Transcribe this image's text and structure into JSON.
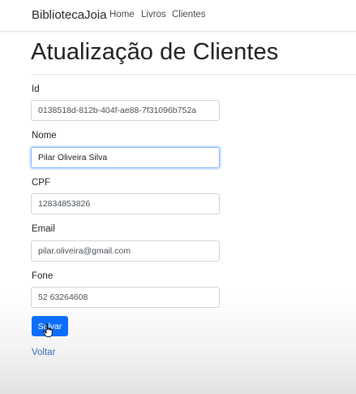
{
  "navbar": {
    "brand": "BibliotecaJoia",
    "links": [
      "Home",
      "Livros",
      "Clientes"
    ]
  },
  "page": {
    "title": "Atualização de Clientes"
  },
  "form": {
    "fields": [
      {
        "label": "Id",
        "value": "0138518d-812b-404f-ae88-7f31096b752a"
      },
      {
        "label": "Nome",
        "value": "Pilar Oliveira Silva"
      },
      {
        "label": "CPF",
        "value": "12834853826"
      },
      {
        "label": "Email",
        "value": "pilar.oliveira@gmail.com"
      },
      {
        "label": "Fone",
        "value": "52 63264608"
      }
    ],
    "submit_label": "Salvar",
    "back_label": "Voltar"
  },
  "colors": {
    "primary": "#0d6efd",
    "link": "#3b6fb6",
    "focus_border": "#86b7fe"
  },
  "icons": {
    "cursor": "hand-pointer-icon"
  }
}
